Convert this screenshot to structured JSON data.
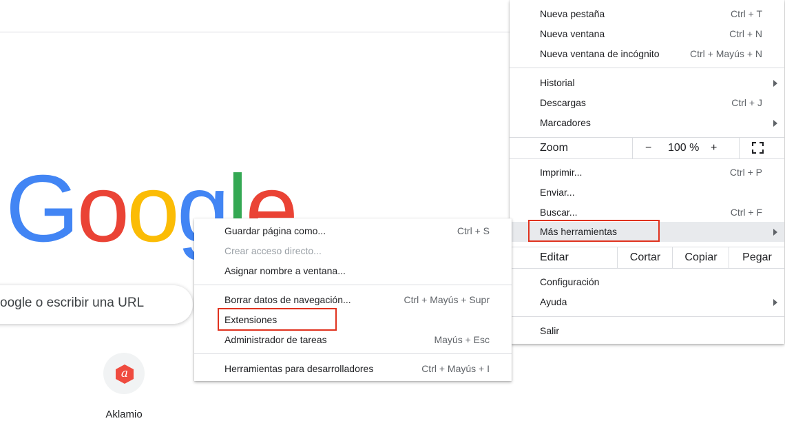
{
  "page": {
    "logo": [
      "G",
      "o",
      "o",
      "g",
      "l",
      "e"
    ],
    "logo_colors": [
      "#4285f4",
      "#ea4335",
      "#fbbc05",
      "#4285f4",
      "#34a853",
      "#ea4335"
    ],
    "search_placeholder": "oogle o escribir una URL",
    "shortcut": {
      "label": "Aklamio",
      "icon_glyph": "a",
      "icon": "aklamio-icon",
      "icon_color": "#ef4b3f"
    }
  },
  "main_menu": {
    "items": [
      {
        "label": "Nueva pestaña",
        "shortcut": "Ctrl + T"
      },
      {
        "label": "Nueva ventana",
        "shortcut": "Ctrl + N"
      },
      {
        "label": "Nueva ventana de incógnito",
        "shortcut": "Ctrl + Mayús + N"
      },
      {
        "label": "Historial",
        "shortcut": ""
      },
      {
        "label": "Descargas",
        "shortcut": "Ctrl + J"
      },
      {
        "label": "Marcadores",
        "shortcut": ""
      },
      {
        "label": "Imprimir...",
        "shortcut": "Ctrl + P"
      },
      {
        "label": "Enviar...",
        "shortcut": ""
      },
      {
        "label": "Buscar...",
        "shortcut": "Ctrl + F"
      },
      {
        "label": "Más herramientas",
        "shortcut": ""
      },
      {
        "label": "Configuración",
        "shortcut": ""
      },
      {
        "label": "Ayuda",
        "shortcut": ""
      },
      {
        "label": "Salir",
        "shortcut": ""
      }
    ],
    "zoom": {
      "label": "Zoom",
      "minus": "−",
      "value": "100 %",
      "plus": "+"
    },
    "edit": {
      "label": "Editar",
      "cut": "Cortar",
      "copy": "Copiar",
      "paste": "Pegar"
    }
  },
  "sub_menu": {
    "items": [
      {
        "label": "Guardar página como...",
        "shortcut": "Ctrl + S"
      },
      {
        "label": "Crear acceso directo...",
        "shortcut": ""
      },
      {
        "label": "Asignar nombre a ventana...",
        "shortcut": ""
      },
      {
        "label": "Borrar datos de navegación...",
        "shortcut": "Ctrl + Mayús + Supr"
      },
      {
        "label": "Extensiones",
        "shortcut": ""
      },
      {
        "label": "Administrador de tareas",
        "shortcut": "Mayús + Esc"
      },
      {
        "label": "Herramientas para desarrolladores",
        "shortcut": "Ctrl + Mayús + I"
      }
    ]
  },
  "colors": {
    "highlight": "#e0321e",
    "hover": "#e8eaed"
  }
}
